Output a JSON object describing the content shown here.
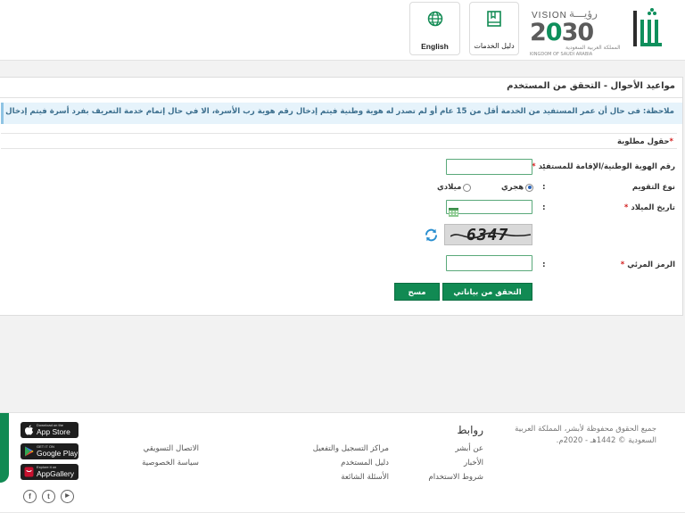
{
  "header": {
    "vision_word": "VISION",
    "vision_ar": "رؤيـــة",
    "vision_year_pre": "2",
    "vision_year_zero": "0",
    "vision_year_post": "30",
    "vision_sub_ar": "المملكة العربية السعودية",
    "vision_sub_en": "KINGDOM OF SAUDI ARABIA",
    "services_guide_label": "دليل الخدمات",
    "english_label": "English",
    "brand_color": "#118a53"
  },
  "main": {
    "title": "مواعيد الأحوال - التحقق من المستخدم",
    "note": "ملاحظة: فى حال أن عمر المستفيد من الخدمة أقل من 15 عام أو لم تصدر له هوية وطنية فيتم إدخال رقم هوية رب الأسرة، الا في حال إتمام خدمة التعريف بفرد أسرة فيتم إدخال رقم هوية الفرد.",
    "required_star": "*",
    "required_text": "حقول مطلوبة",
    "fields": {
      "id_label": "رقم الهوية الوطنية/الإقامة للمستفيد",
      "calendar_label": "نوع التقويم",
      "hijri_label": "هجري",
      "gregorian_label": "ميلادي",
      "birthdate_label": "تاريخ الميلاد",
      "captcha_value": "6347",
      "code_label": "الرمز المرئي",
      "colon": ":",
      "star": "*",
      "calendar_selected": "hijri"
    },
    "buttons": {
      "verify": "التحقق من بياناتي",
      "clear": "مسح"
    }
  },
  "footer": {
    "copyright": "جميع الحقوق محفوظة لأبشر، المملكة العربية السعودية © 1442هـ - 2020م.",
    "links_title": "روابط",
    "links_col1": [
      "عن أبشر",
      "الأخبار",
      "شروط الاستخدام"
    ],
    "links_col2": [
      "مراكز التسجيل والتفعيل",
      "دليل المستخدم",
      "الأسئلة الشائعة"
    ],
    "links_col3": [
      "الاتصال التسويقي",
      "سياسة الخصوصية"
    ],
    "stores": [
      {
        "small": "Download on the",
        "big": "App Store",
        "icon": "apple-icon"
      },
      {
        "small": "GET IT ON",
        "big": "Google Play",
        "icon": "google-play-icon"
      },
      {
        "small": "Explore it on",
        "big": "AppGallery",
        "icon": "huawei-icon"
      }
    ],
    "social": [
      {
        "glyph": "f",
        "icon": "facebook-icon"
      },
      {
        "glyph": "t",
        "icon": "twitter-icon"
      },
      {
        "glyph": "▶",
        "icon": "youtube-icon"
      }
    ]
  }
}
